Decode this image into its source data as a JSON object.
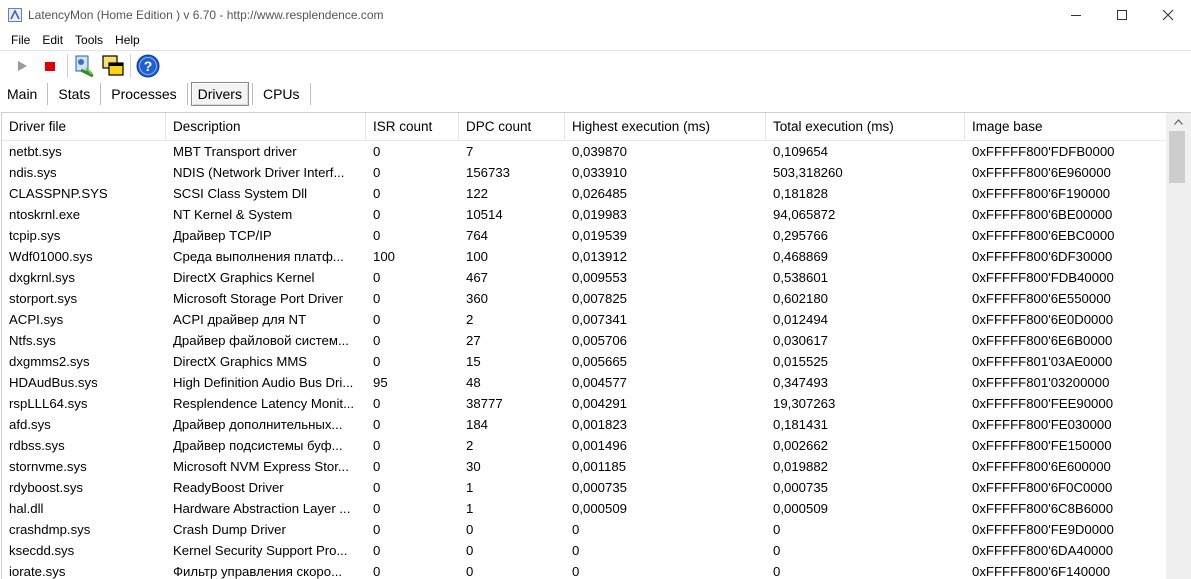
{
  "window": {
    "title": "LatencyMon  (Home Edition )  v 6.70 - http://www.resplendence.com"
  },
  "menu": [
    "File",
    "Edit",
    "Tools",
    "Help"
  ],
  "toolbar": {
    "icons": [
      "play-icon",
      "stop-icon",
      "driver-update-icon",
      "windows-icon",
      "help-icon"
    ]
  },
  "tabs": [
    {
      "label": "Main",
      "active": false
    },
    {
      "label": "Stats",
      "active": false
    },
    {
      "label": "Processes",
      "active": false
    },
    {
      "label": "Drivers",
      "active": true
    },
    {
      "label": "CPUs",
      "active": false
    }
  ],
  "table": {
    "columns": [
      "Driver file",
      "Description",
      "ISR count",
      "DPC count",
      "Highest execution (ms)",
      "Total execution (ms)",
      "Image base"
    ],
    "rows": [
      [
        "netbt.sys",
        "MBT Transport driver",
        "0",
        "7",
        "0,039870",
        "0,109654",
        "0xFFFFF800'FDFB0000"
      ],
      [
        "ndis.sys",
        "NDIS (Network Driver Interf...",
        "0",
        "156733",
        "0,033910",
        "503,318260",
        "0xFFFFF800'6E960000"
      ],
      [
        "CLASSPNP.SYS",
        "SCSI Class System Dll",
        "0",
        "122",
        "0,026485",
        "0,181828",
        "0xFFFFF800'6F190000"
      ],
      [
        "ntoskrnl.exe",
        "NT Kernel & System",
        "0",
        "10514",
        "0,019983",
        "94,065872",
        "0xFFFFF800'6BE00000"
      ],
      [
        "tcpip.sys",
        "Драйвер TCP/IP",
        "0",
        "764",
        "0,019539",
        "0,295766",
        "0xFFFFF800'6EBC0000"
      ],
      [
        "Wdf01000.sys",
        "Среда выполнения платф...",
        "100",
        "100",
        "0,013912",
        "0,468869",
        "0xFFFFF800'6DF30000"
      ],
      [
        "dxgkrnl.sys",
        "DirectX Graphics Kernel",
        "0",
        "467",
        "0,009553",
        "0,538601",
        "0xFFFFF800'FDB40000"
      ],
      [
        "storport.sys",
        "Microsoft Storage Port Driver",
        "0",
        "360",
        "0,007825",
        "0,602180",
        "0xFFFFF800'6E550000"
      ],
      [
        "ACPI.sys",
        "ACPI драйвер для NT",
        "0",
        "2",
        "0,007341",
        "0,012494",
        "0xFFFFF800'6E0D0000"
      ],
      [
        "Ntfs.sys",
        "Драйвер файловой систем...",
        "0",
        "27",
        "0,005706",
        "0,030617",
        "0xFFFFF800'6E6B0000"
      ],
      [
        "dxgmms2.sys",
        "DirectX Graphics MMS",
        "0",
        "15",
        "0,005665",
        "0,015525",
        "0xFFFFF801'03AE0000"
      ],
      [
        "HDAudBus.sys",
        "High Definition Audio Bus Dri...",
        "95",
        "48",
        "0,004577",
        "0,347493",
        "0xFFFFF801'03200000"
      ],
      [
        "rspLLL64.sys",
        "Resplendence Latency Monit...",
        "0",
        "38777",
        "0,004291",
        "19,307263",
        "0xFFFFF800'FEE90000"
      ],
      [
        "afd.sys",
        "Драйвер дополнительных...",
        "0",
        "184",
        "0,001823",
        "0,181431",
        "0xFFFFF800'FE030000"
      ],
      [
        "rdbss.sys",
        "Драйвер подсистемы буф...",
        "0",
        "2",
        "0,001496",
        "0,002662",
        "0xFFFFF800'FE150000"
      ],
      [
        "stornvme.sys",
        "Microsoft NVM Express Stor...",
        "0",
        "30",
        "0,001185",
        "0,019882",
        "0xFFFFF800'6E600000"
      ],
      [
        "rdyboost.sys",
        "ReadyBoost Driver",
        "0",
        "1",
        "0,000735",
        "0,000735",
        "0xFFFFF800'6F0C0000"
      ],
      [
        "hal.dll",
        "Hardware Abstraction Layer ...",
        "0",
        "1",
        "0,000509",
        "0,000509",
        "0xFFFFF800'6C8B6000"
      ],
      [
        "crashdmp.sys",
        "Crash Dump Driver",
        "0",
        "0",
        "0",
        "0",
        "0xFFFFF800'FE9D0000"
      ],
      [
        "ksecdd.sys",
        "Kernel Security Support Pro...",
        "0",
        "0",
        "0",
        "0",
        "0xFFFFF800'6DA40000"
      ],
      [
        "iorate.sys",
        "Фильтр управления скоро...",
        "0",
        "0",
        "0",
        "0",
        "0xFFFFF800'6F140000"
      ]
    ]
  }
}
